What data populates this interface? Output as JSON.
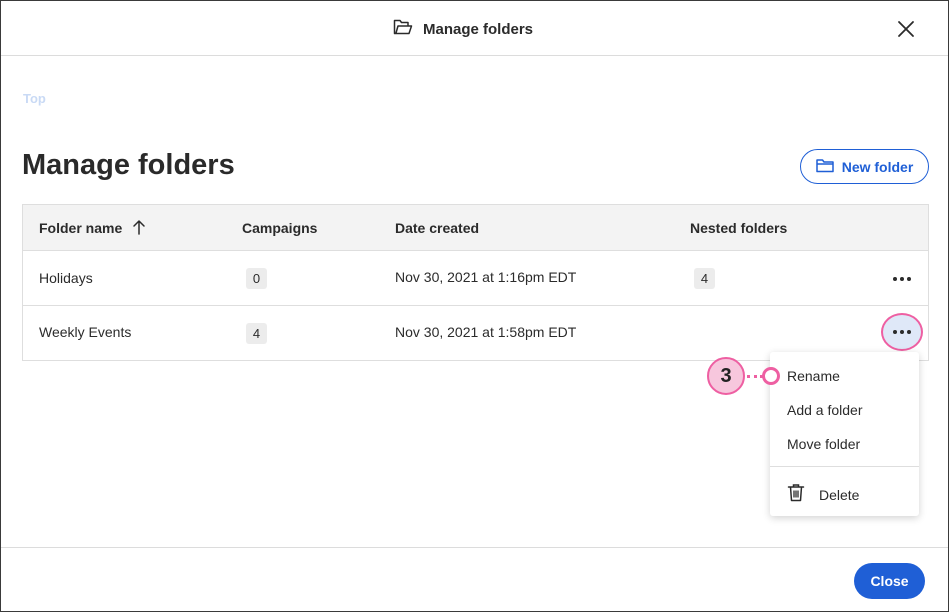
{
  "header": {
    "title": "Manage folders"
  },
  "breadcrumb": {
    "top": "Top"
  },
  "page": {
    "title": "Manage folders",
    "new_folder_label": "New folder"
  },
  "table": {
    "headers": [
      "Folder name",
      "Campaigns",
      "Date created",
      "Nested folders"
    ],
    "sort_column": "Folder name",
    "sort_direction": "ascending",
    "rows": [
      {
        "name": "Holidays",
        "campaigns": "0",
        "date_created": "Nov 30, 2021 at 1:16pm EDT",
        "nested": "4"
      },
      {
        "name": "Weekly Events",
        "campaigns": "4",
        "date_created": "Nov 30, 2021 at 1:58pm EDT",
        "nested": ""
      }
    ]
  },
  "menu": {
    "items": [
      "Rename",
      "Add a folder",
      "Move folder"
    ],
    "delete_label": "Delete"
  },
  "annotation": {
    "step": "3"
  },
  "footer": {
    "close_label": "Close"
  },
  "colors": {
    "accent": "#1f5fd6",
    "highlight": "#ee5fa2",
    "badge_fill": "#f7c7dd"
  },
  "icons": {
    "header": "folder-open-icon",
    "new_folder": "folder-icon",
    "sort": "arrow-up-icon",
    "delete": "trash-icon",
    "close": "close-icon"
  }
}
